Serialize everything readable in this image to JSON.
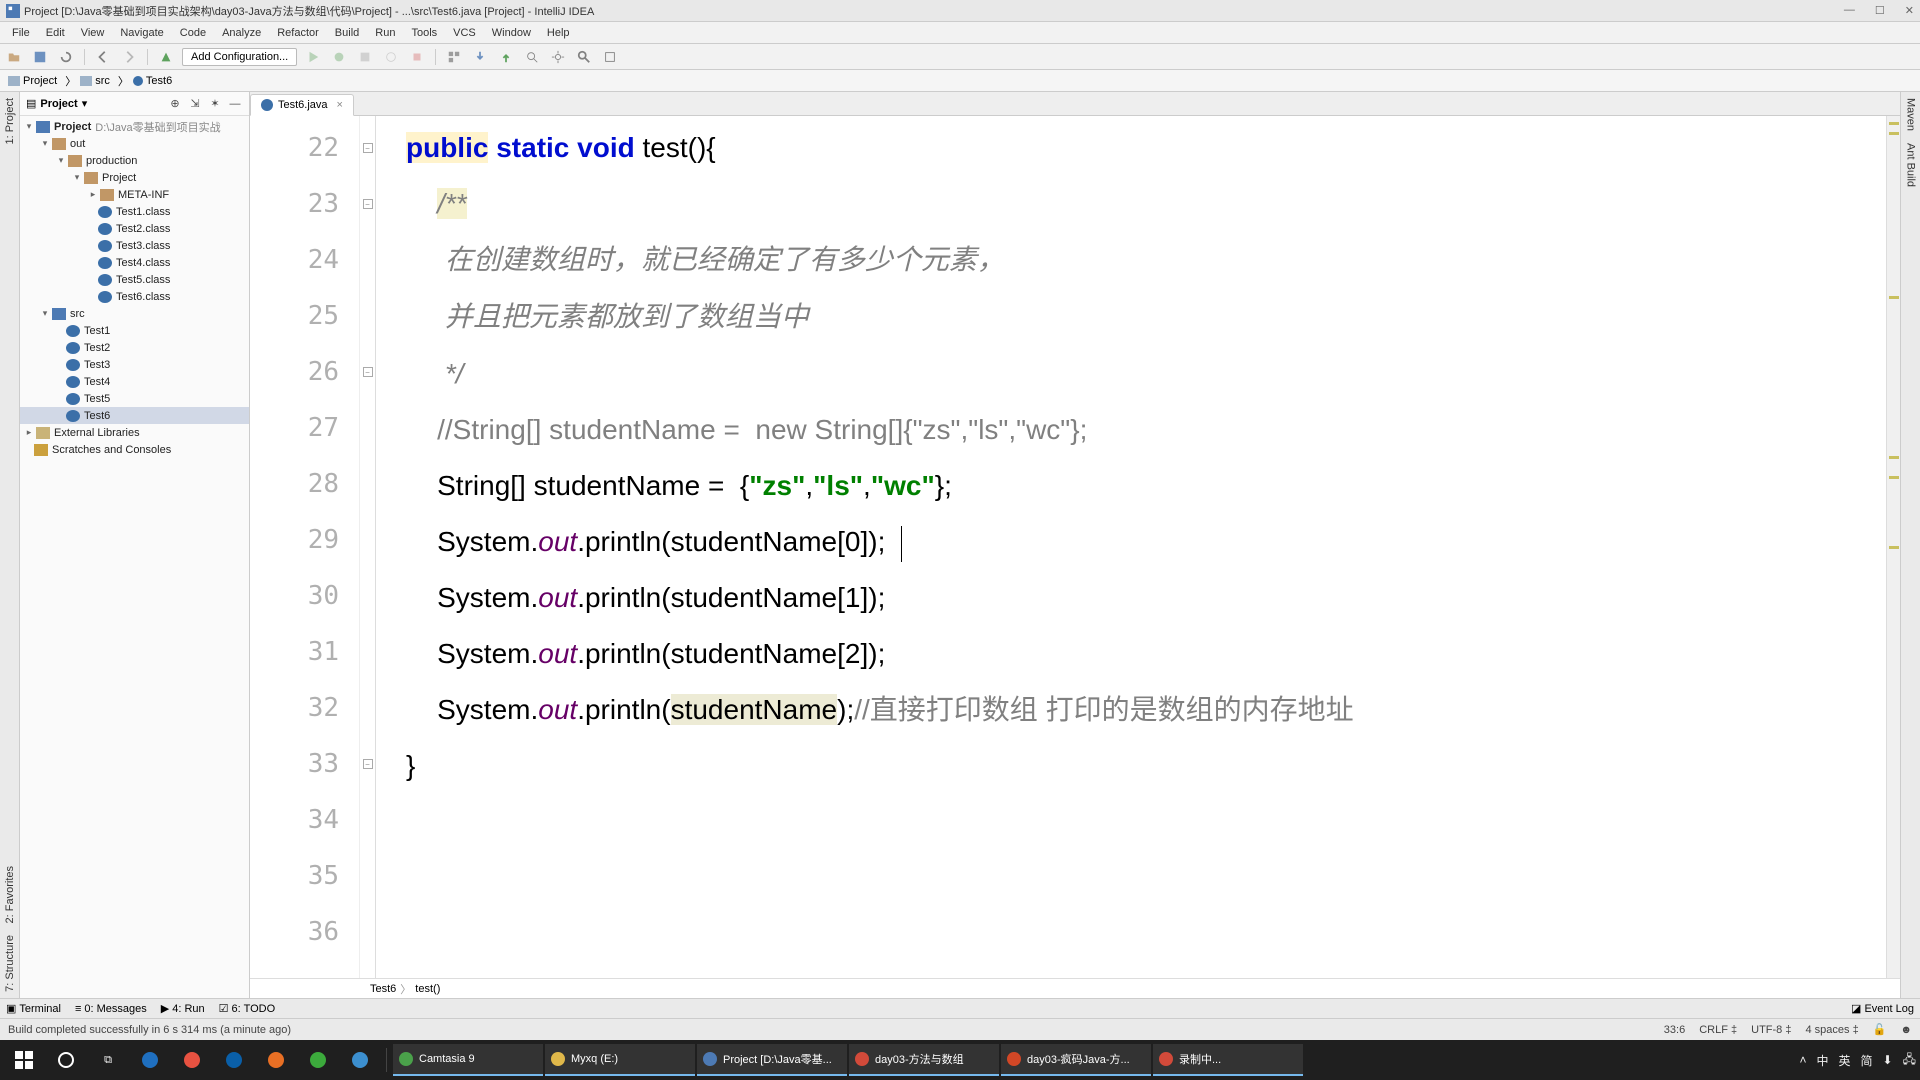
{
  "title_bar": {
    "text": "Project [D:\\Java零基础到项目实战架构\\day03-Java方法与数组\\代码\\Project] - ...\\src\\Test6.java [Project] - IntelliJ IDEA"
  },
  "menu": [
    "File",
    "Edit",
    "View",
    "Navigate",
    "Code",
    "Analyze",
    "Refactor",
    "Build",
    "Run",
    "Tools",
    "VCS",
    "Window",
    "Help"
  ],
  "toolbar": {
    "add_config": "Add Configuration..."
  },
  "nav_crumbs": [
    "Project",
    "src",
    "Test6"
  ],
  "project_panel": {
    "title": "Project",
    "root": {
      "name": "Project",
      "path": "D:\\Java零基础到项目实战"
    },
    "out": "out",
    "production": "production",
    "inner_project": "Project",
    "meta_inf": "META-INF",
    "classes": [
      "Test1.class",
      "Test2.class",
      "Test3.class",
      "Test4.class",
      "Test5.class",
      "Test6.class"
    ],
    "src": "src",
    "tests": [
      "Test1",
      "Test2",
      "Test3",
      "Test4",
      "Test5",
      "Test6"
    ],
    "ext_libs": "External Libraries",
    "scratches": "Scratches and Consoles"
  },
  "editor": {
    "tab": "Test6.java",
    "lines": [
      22,
      23,
      24,
      25,
      26,
      27,
      28,
      29,
      30,
      31,
      32,
      33,
      34,
      35,
      36
    ],
    "breadcrumb": {
      "cls": "Test6",
      "method": "test()"
    },
    "code": {
      "l22": {
        "kw1": "public",
        "kw2": "static",
        "kw3": "void",
        "name": "test",
        "paren": "(){"
      },
      "l23": "/**",
      "l24": "在创建数组时，就已经确定了有多少个元素，",
      "l25": "并且把元素都放到了数组当中",
      "l26": "*/",
      "l27": "//String[] studentName =  new String[]{\"zs\",\"ls\",\"wc\"};",
      "l28": {
        "type": "String",
        "arr": "[]",
        "var": "studentName",
        "eq": " = ",
        "open": "{",
        "s1": "\"zs\"",
        "c1": ",",
        "s2": "\"ls\"",
        "c2": ",",
        "s3": "\"wc\"",
        "close": "};"
      },
      "l29": {
        "cls": "System",
        "dot1": ".",
        "out": "out",
        "dot2": ".",
        "call": "println(studentName[",
        "idx": "0",
        "end": "]);"
      },
      "l30": {
        "cls": "System",
        "dot1": ".",
        "out": "out",
        "dot2": ".",
        "call": "println(studentName[",
        "idx": "1",
        "end": "]);"
      },
      "l31": {
        "cls": "System",
        "dot1": ".",
        "out": "out",
        "dot2": ".",
        "call": "println(studentName[",
        "idx": "2",
        "end": "]);"
      },
      "l32": {
        "cls": "System",
        "dot1": ".",
        "out": "out",
        "dot2": ".",
        "call": "println(",
        "arg": "studentName",
        "close": ");",
        "cmt": "//直接打印数组 打印的是数组的内存地址"
      },
      "l33": "}"
    }
  },
  "vert_tabs": {
    "left_project": "1: Project",
    "left_structure": "7: Structure",
    "left_fav": "2: Favorites",
    "right_maven": "Maven",
    "right_ant": "Ant Build"
  },
  "bottom_tabs": {
    "terminal": "Terminal",
    "messages": "0: Messages",
    "run": "4: Run",
    "todo": "6: TODO",
    "event_log": "Event Log"
  },
  "status": {
    "msg": "Build completed successfully in 6 s 314 ms (a minute ago)",
    "pos": "33:6",
    "crlf": "CRLF",
    "encoding": "UTF-8",
    "indent": "4 spaces"
  },
  "taskbar": {
    "items": [
      "Camtasia 9",
      "Myxq (E:)",
      "Project [D:\\Java零基...",
      "day03-方法与数组",
      "day03-疯码Java-方...",
      "录制中..."
    ],
    "tray": {
      "pin": "中",
      "lang": "英",
      "ext1": "简",
      "ext2": "⬇"
    }
  }
}
